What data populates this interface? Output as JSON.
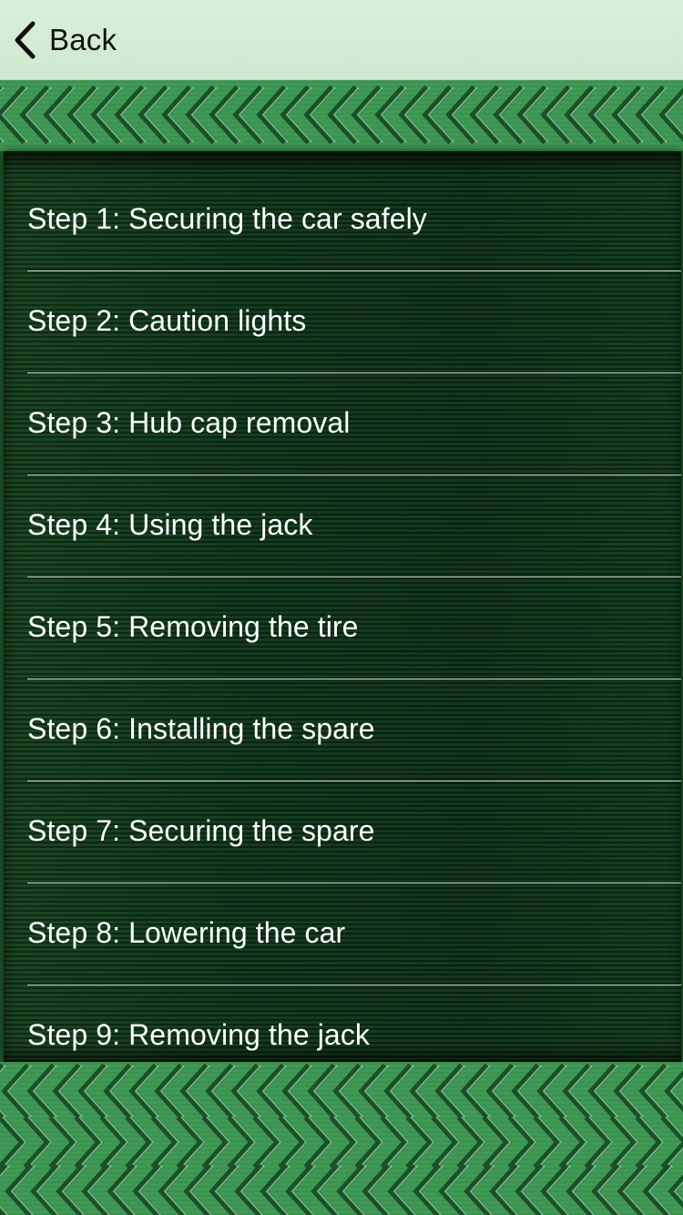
{
  "nav": {
    "back_label": "Back"
  },
  "steps": [
    {
      "label": "Step 1: Securing the car safely"
    },
    {
      "label": "Step 2: Caution lights"
    },
    {
      "label": "Step 3: Hub cap removal"
    },
    {
      "label": "Step 4: Using the jack"
    },
    {
      "label": "Step 5: Removing the tire"
    },
    {
      "label": "Step 6: Installing the spare"
    },
    {
      "label": "Step 7: Securing the spare"
    },
    {
      "label": "Step 8: Lowering the car"
    },
    {
      "label": "Step 9: Removing the jack"
    }
  ],
  "theme": {
    "nav_bg": "#d3ebd3",
    "tread_green": "#3f9a55",
    "panel_bg": "#123a1d",
    "text": "#ffffff"
  },
  "icons": {
    "back": "chevron-left-icon"
  }
}
